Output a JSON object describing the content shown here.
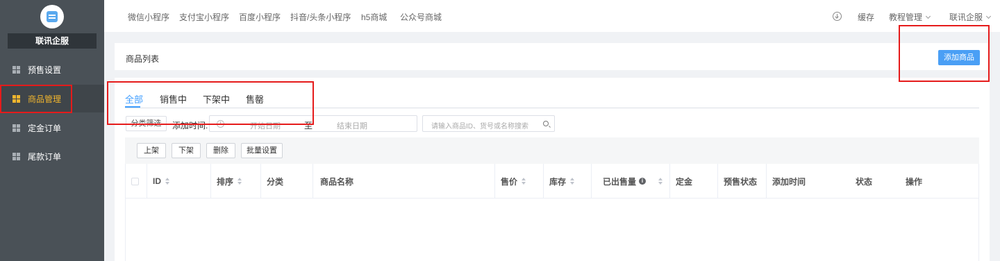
{
  "sidebar": {
    "brand": "联讯企服",
    "items": [
      {
        "label": "预售设置",
        "active": false
      },
      {
        "label": "商品管理",
        "active": true
      },
      {
        "label": "定金订单",
        "active": false
      },
      {
        "label": "尾款订单",
        "active": false
      }
    ]
  },
  "topbar": {
    "links": [
      "微信小程序",
      "支付宝小程序",
      "百度小程序",
      "抖音/头条小程序",
      "h5商城",
      "公众号商城"
    ],
    "cache": "缓存",
    "tutorial": "教程管理",
    "account": "联讯企服"
  },
  "header": {
    "title": "商品列表",
    "add_button": "添加商品"
  },
  "tabs": [
    "全部",
    "销售中",
    "下架中",
    "售罄"
  ],
  "filters": {
    "category_button": "分类筛选",
    "add_time_label": "添加时间:",
    "date_start_placeholder": "开始日期",
    "date_separator": "至",
    "date_end_placeholder": "结束日期",
    "search_placeholder": "请输入商品ID、货号或名称搜索"
  },
  "actions": [
    "上架",
    "下架",
    "删除",
    "批量设置"
  ],
  "table": {
    "columns": [
      "ID",
      "排序",
      "分类",
      "商品名称",
      "售价",
      "库存",
      "已出售量",
      "定金",
      "预售状态",
      "添加时间",
      "状态",
      "操作"
    ]
  },
  "colors": {
    "sidebar_bg": "#4a5157",
    "active_menu": "#f0b52e",
    "primary": "#409eff",
    "highlight": "#e51b1b"
  }
}
